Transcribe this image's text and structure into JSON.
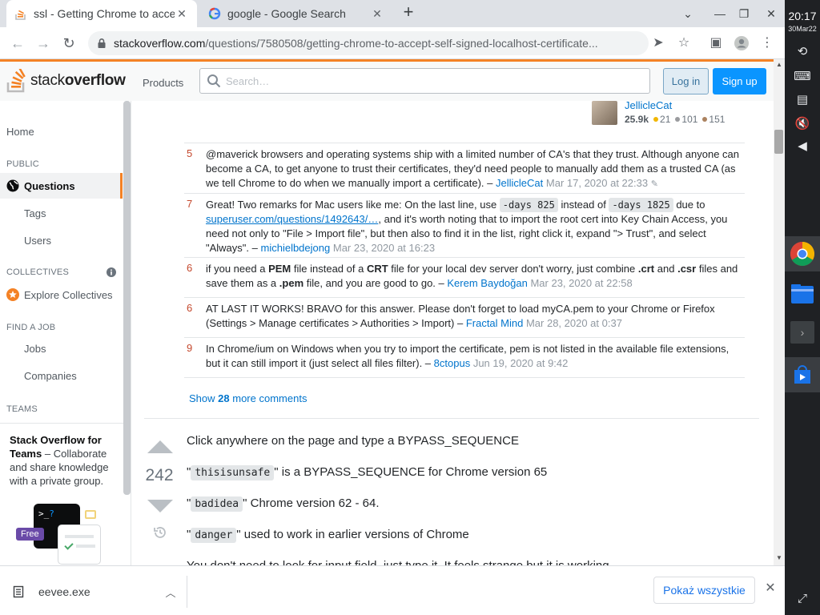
{
  "browser": {
    "tabs": [
      {
        "title": "ssl - Getting Chrome to accep",
        "active": true,
        "close": "✕"
      },
      {
        "title": "google - Google Search",
        "active": false,
        "close": "✕"
      }
    ],
    "new_tab": "+",
    "url_host": "stackoverflow.com",
    "url_path": "/questions/7580508/getting-chrome-to-accept-self-signed-localhost-certificate..."
  },
  "header": {
    "logo_light": "stack",
    "logo_bold": "overflow",
    "products": "Products",
    "search_placeholder": "Search…",
    "login": "Log in",
    "signup": "Sign up"
  },
  "leftnav": {
    "home": "Home",
    "public": "PUBLIC",
    "questions": "Questions",
    "tags": "Tags",
    "users": "Users",
    "collectives": "COLLECTIVES",
    "explore_collectives": "Explore Collectives",
    "find_a_job": "FIND A JOB",
    "jobs": "Jobs",
    "companies": "Companies",
    "teams": "TEAMS",
    "teams_title": "Stack Overflow for Teams",
    "teams_desc": "– Collaborate and share knowledge with a private group.",
    "free_badge": "Free"
  },
  "user_card": {
    "name": "JellicleCat",
    "reputation": "25.9k",
    "gold": "21",
    "silver": "101",
    "bronze": "151"
  },
  "comments": [
    {
      "score": "5",
      "text": "@maverick browsers and operating systems ship with a limited number of CA's that they trust. Although anyone can become a CA, to get anyone to trust their certificates, they'd need people to manually add them as a trusted CA (as we tell Chrome to do when we manually import a certificate). –",
      "user": "JellicleCat",
      "date": "Mar 17, 2020 at 22:33"
    },
    {
      "score": "7",
      "t1": "Great! Two remarks for Mac users like me: On the last line, use",
      "code1": "-days 825",
      "t2": "instead of",
      "code2": "-days 1825",
      "t3": "due to",
      "link": "superuser.com/questions/1492643/…",
      "t4": ", and it's worth noting that to import the root cert into Key Chain Access, you need not only to \"File > Import file\", but then also to find it in the list, right click it, expand \"> Trust\", and select \"Always\". –",
      "user": "michielbdejong",
      "date": "Mar 23, 2020 at 16:23"
    },
    {
      "score": "6",
      "t1": "if you need a",
      "b1": "PEM",
      "t2": "file instead of a",
      "b2": "CRT",
      "t3": "file for your local dev server don't worry, just combine",
      "b3": ".crt",
      "t4": "and",
      "b4": ".csr",
      "t5": "files and save them as a",
      "b5": ".pem",
      "t6": "file, and you are good to go. –",
      "user": "Kerem Baydoğan",
      "date": "Mar 23, 2020 at 22:58"
    },
    {
      "score": "6",
      "text": "AT LAST IT WORKS! BRAVO for this answer. Please don't forget to load myCA.pem to your Chrome or Firefox (Settings > Manage certificates > Authorities > Import) –",
      "user": "Fractal Mind",
      "date": "Mar 28, 2020 at 0:37"
    },
    {
      "score": "9",
      "text": "In Chrome/ium on Windows when you try to import the certificate, pem is not listed in the available file extensions, but it can still import it (just select all files filter). –",
      "user": "8ctopus",
      "date": "Jun 19, 2020 at 9:42"
    }
  ],
  "show_more": {
    "prefix": "Show",
    "count": "28",
    "suffix": "more comments"
  },
  "answer": {
    "votes": "242",
    "p1": "Click anywhere on the page and type a BYPASS_SEQUENCE",
    "p2_code": "thisisunsafe",
    "p2_text": "is a BYPASS_SEQUENCE for Chrome version 65",
    "p3_code": "badidea",
    "p3_text": "Chrome version 62 - 64.",
    "p4_code": "danger",
    "p4_text": "used to work in earlier versions of Chrome",
    "p5": "You don't need to look for input field, just type it. It feels strange but it is working."
  },
  "downloads": {
    "file": "eevee.exe",
    "show_all": "Pokaż wszystkie"
  },
  "shelf": {
    "time": "20:17",
    "date": "30Mar22"
  },
  "colors": {
    "so_orange": "#f48225",
    "so_blue": "#0a95ff",
    "link": "#0074cc",
    "shelf_bg": "#1f2124"
  }
}
